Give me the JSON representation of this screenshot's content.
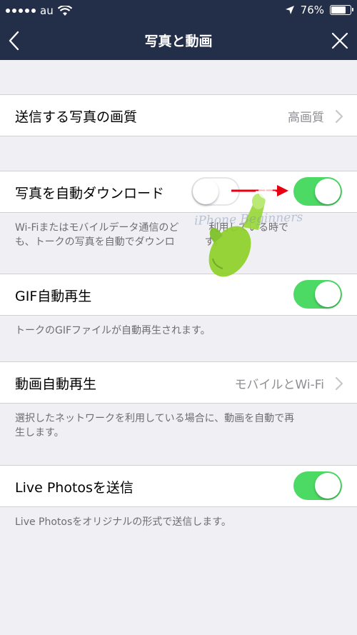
{
  "status_bar": {
    "carrier": "au",
    "battery_percent": "76%",
    "battery_level": 0.76,
    "icons": [
      "signal-icon",
      "wifi-icon",
      "location-icon",
      "battery-icon"
    ]
  },
  "nav": {
    "title": "写真と動画",
    "back_icon": "chevron-left-icon",
    "close_icon": "close-icon"
  },
  "rows": {
    "photo_quality": {
      "label": "送信する写真の画質",
      "value": "高画質"
    },
    "auto_download": {
      "label": "写真を自動ダウンロード",
      "toggle_before": false,
      "toggle_after": true,
      "footer_line1": "Wi-Fiまたはモバイルデータ通信のど　　　利用している時で",
      "footer_line2": "も、トークの写真を自動でダウンロ　　　す。"
    },
    "gif_autoplay": {
      "label": "GIF自動再生",
      "on": true,
      "footer": "トークのGIFファイルが自動再生されます。"
    },
    "video_autoplay": {
      "label": "動画自動再生",
      "value": "モバイルとWi-Fi",
      "footer_line1": "選択したネットワークを利用している場合に、動画を自動で再",
      "footer_line2": "生します。"
    },
    "live_photos": {
      "label": "Live Photosを送信",
      "on": true,
      "footer": "Live Photosをオリジナルの形式で送信します。"
    }
  },
  "annotation": {
    "watermark": "iPhone Beginners",
    "arrow_color": "#e60012",
    "hand_color": "#8fd12a"
  },
  "colors": {
    "nav_bg": "#232e49",
    "toggle_on": "#4cd964",
    "page_bg": "#efeff4",
    "secondary_text": "#8e8e93"
  }
}
